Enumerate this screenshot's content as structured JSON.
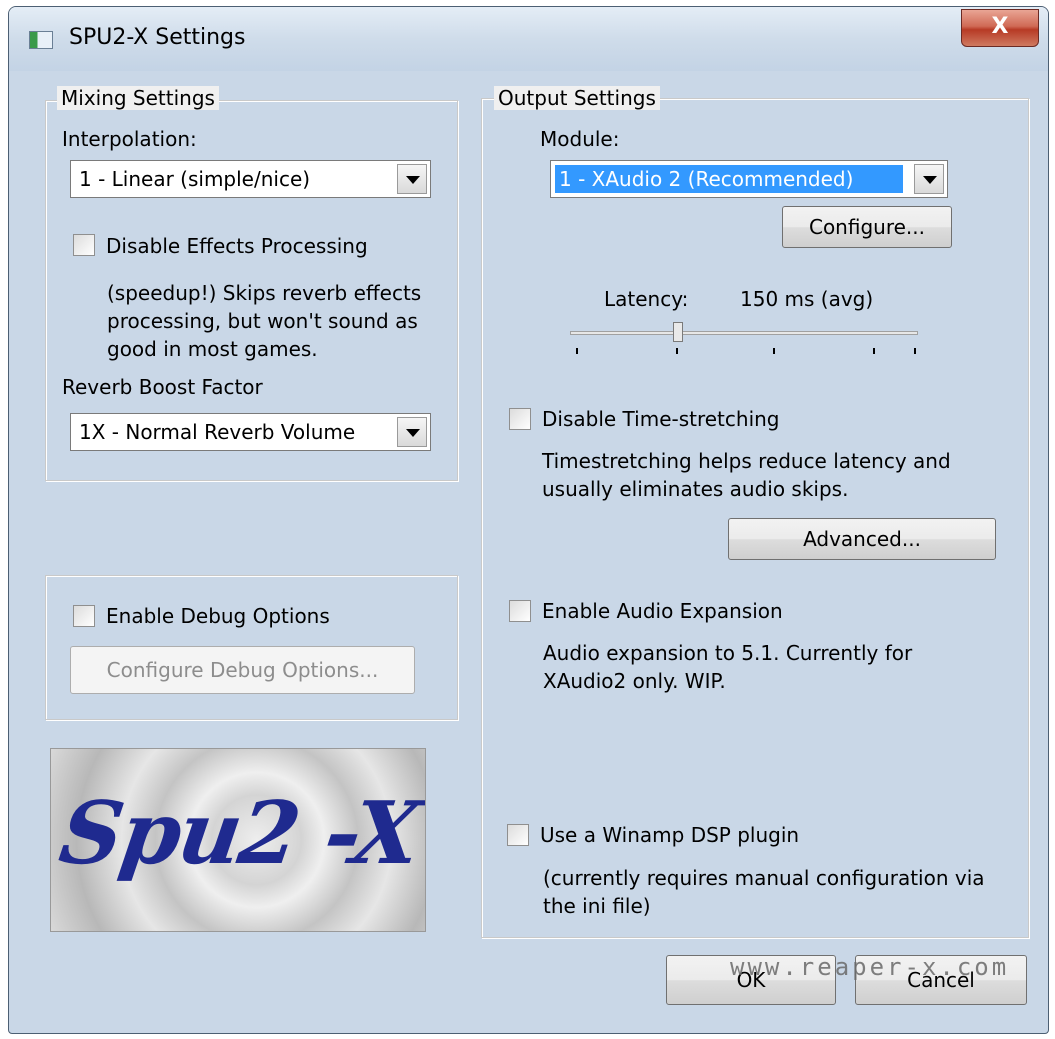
{
  "window": {
    "title": "SPU2-X Settings",
    "close_label": "X"
  },
  "mixing": {
    "legend": "Mixing Settings",
    "interpolation_label": "Interpolation:",
    "interpolation_value": "1 - Linear (simple/nice)",
    "disable_effects_label": "Disable Effects Processing",
    "disable_effects_checked": false,
    "effects_desc": [
      "(speedup!) Skips reverb effects",
      "processing, but won't sound as",
      "good in most games."
    ],
    "reverb_label": "Reverb Boost Factor",
    "reverb_value": "1X - Normal Reverb Volume"
  },
  "debug": {
    "enable_label": "Enable Debug Options",
    "enable_checked": false,
    "configure_label": "Configure Debug Options..."
  },
  "logo": {
    "text": "Spu2 -X"
  },
  "output": {
    "legend": "Output Settings",
    "module_label": "Module:",
    "module_value": "1 - XAudio 2 (Recommended)",
    "configure_label": "Configure...",
    "latency_label": "Latency:",
    "latency_value": "150 ms (avg)",
    "latency_slider_fraction": 0.31,
    "timestretch_label": "Disable Time-stretching",
    "timestretch_checked": false,
    "timestretch_desc": [
      "Timestretching helps reduce latency and",
      "usually eliminates audio skips."
    ],
    "advanced_label": "Advanced...",
    "expansion_label": "Enable Audio Expansion",
    "expansion_checked": false,
    "expansion_desc": [
      "Audio expansion to 5.1. Currently for",
      "XAudio2 only. WIP."
    ],
    "winamp_label": "Use a Winamp DSP plugin",
    "winamp_checked": false,
    "winamp_desc": [
      "(currently requires manual configuration via",
      "the ini file)"
    ]
  },
  "footer": {
    "ok_label": "OK",
    "cancel_label": "Cancel"
  },
  "watermark": "www.reaper-x.com"
}
